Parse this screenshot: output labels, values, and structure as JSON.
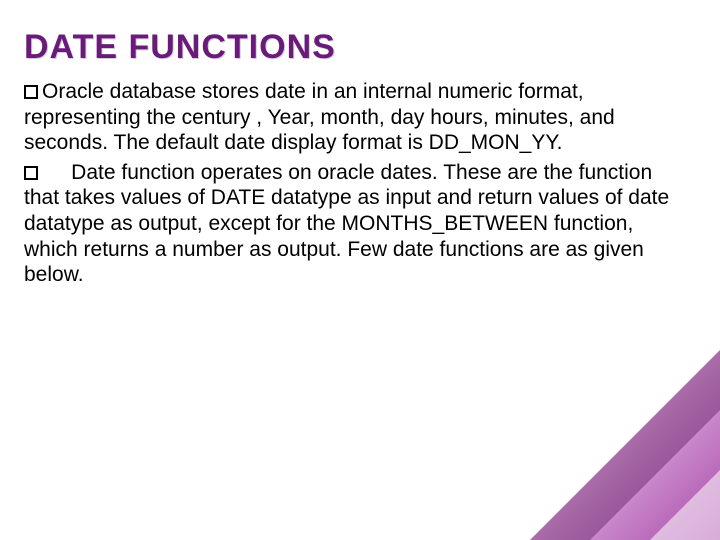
{
  "title": "DATE FUNCTIONS",
  "bullets": [
    "Oracle database stores date in an internal numeric format, representing the century , Year, month, day hours, minutes, and seconds. The default date display format is DD_MON_YY.",
    "     Date function operates on oracle dates. These are the function that takes values of DATE datatype as input and return values of date datatype as output, except for the MONTHS_BETWEEN function, which returns a number as output. Few date functions are as given below."
  ]
}
